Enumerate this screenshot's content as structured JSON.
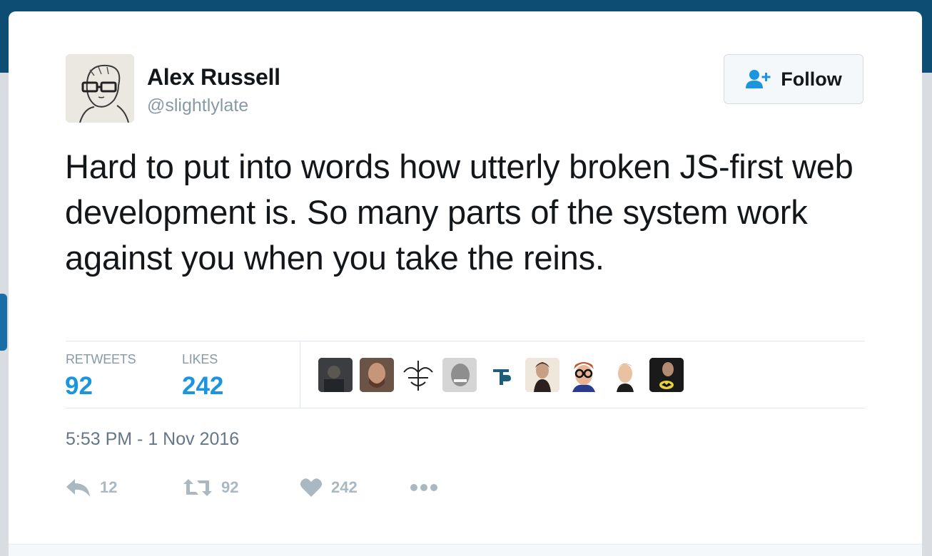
{
  "author": {
    "name": "Alex Russell",
    "handle": "@slightlylate"
  },
  "follow_button": {
    "label": "Follow",
    "icon": "add-user-icon"
  },
  "tweet": {
    "text": "Hard to put into words how utterly broken JS-first web development is. So many parts of the system work against you when you take the reins.",
    "timestamp": "5:53 PM - 1 Nov 2016"
  },
  "stats": {
    "retweets_label": "RETWEETS",
    "retweets_value": "92",
    "likes_label": "LIKES",
    "likes_value": "242"
  },
  "likers": [
    {
      "icon": "liker-avatar-dark"
    },
    {
      "icon": "liker-avatar-bearded"
    },
    {
      "icon": "liker-avatar-sketch"
    },
    {
      "icon": "liker-avatar-bw"
    },
    {
      "icon": "liker-avatar-logo-p"
    },
    {
      "icon": "liker-avatar-woman"
    },
    {
      "icon": "liker-avatar-glasses"
    },
    {
      "icon": "liker-avatar-blond"
    },
    {
      "icon": "liker-avatar-batman-shirt"
    }
  ],
  "actions": {
    "reply_count": "12",
    "retweet_count": "92",
    "like_count": "242"
  },
  "colors": {
    "accent": "#1b95e0",
    "text": "#14171a",
    "muted": "#8899a6",
    "action_gray": "#aab8c2",
    "header_bg": "#0d4d73"
  }
}
